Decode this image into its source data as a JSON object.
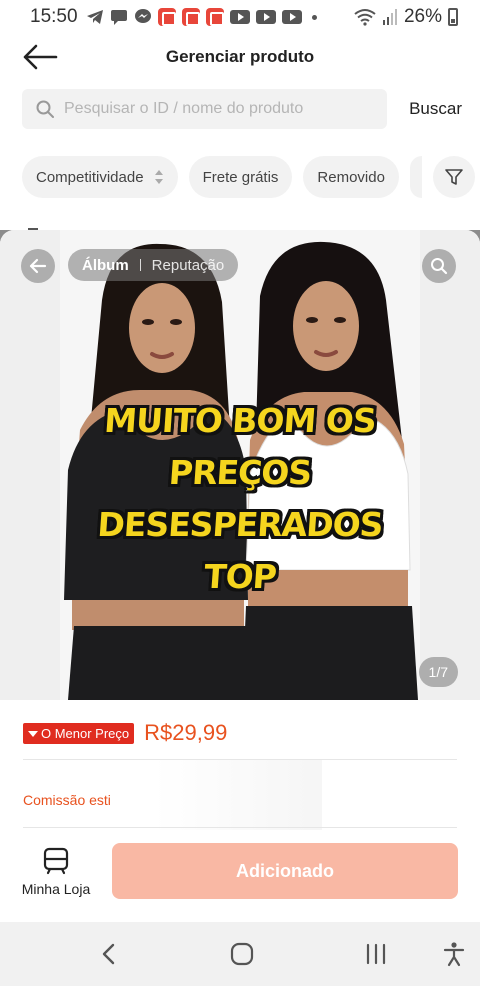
{
  "status_bar": {
    "time": "15:50",
    "battery": "26%"
  },
  "header": {
    "title": "Gerenciar produto"
  },
  "search": {
    "placeholder": "Pesquisar o ID / nome do produto",
    "button_label": "Buscar"
  },
  "filters": {
    "items": [
      "Competitividade",
      "Frete grátis",
      "Removido"
    ]
  },
  "product_modal": {
    "tabs": [
      "Álbum",
      "Reputação"
    ],
    "caption_lines": [
      "MUITO BOM OS",
      "PREÇOS",
      "DESESPERADOS",
      "TOP"
    ],
    "page_indicator": "1/7",
    "price_badge": "O Menor Preço",
    "price": "R$29,99",
    "commission_label": "Comissão esti",
    "store_label": "Minha Loja",
    "added_label": "Adicionado"
  },
  "colors": {
    "accent_orange": "#e8521f",
    "badge_red": "#e02c1f",
    "button_disabled": "#f9b8a4",
    "caption_yellow": "#f5d51e"
  },
  "icons": [
    "back-arrow-icon",
    "search-icon",
    "sort-icon",
    "filter-icon",
    "arrow-left-icon",
    "magnify-icon",
    "store-icon",
    "down-arrow-icon",
    "nav-back-icon",
    "nav-home-icon",
    "nav-recents-icon",
    "accessibility-icon"
  ]
}
